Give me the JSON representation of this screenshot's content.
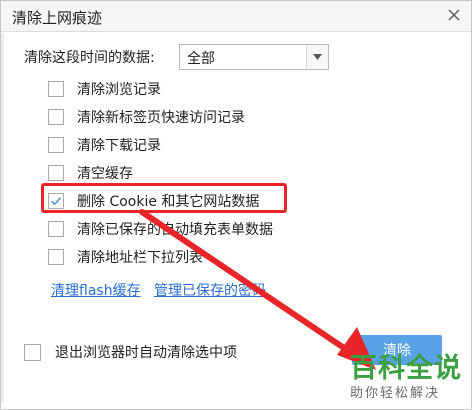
{
  "dialog": {
    "title": "清除上网痕迹"
  },
  "period": {
    "label": "清除这段时间的数据:",
    "selected": "全部"
  },
  "options": [
    {
      "label": "清除浏览记录",
      "checked": false
    },
    {
      "label": "清除新标签页快速访问记录",
      "checked": false
    },
    {
      "label": "清除下载记录",
      "checked": false
    },
    {
      "label": "清空缓存",
      "checked": false
    },
    {
      "label": "删除 Cookie 和其它网站数据",
      "checked": true
    },
    {
      "label": "清除已保存的自动填充表单数据",
      "checked": false
    },
    {
      "label": "清除地址栏下拉列表",
      "checked": false
    }
  ],
  "links": {
    "flash": "清理flash缓存",
    "passwords": "管理已保存的密码"
  },
  "exit_option": {
    "label": "退出浏览器时自动清除选中项",
    "checked": false
  },
  "primary_button": {
    "label": "清除"
  },
  "watermark": {
    "title": "百科全说",
    "subtitle": "助你轻松解决"
  },
  "colors": {
    "highlight": "#e8262a",
    "link": "#2a6fd1",
    "button": "#5aa2e8",
    "watermark": "#3aa043"
  }
}
